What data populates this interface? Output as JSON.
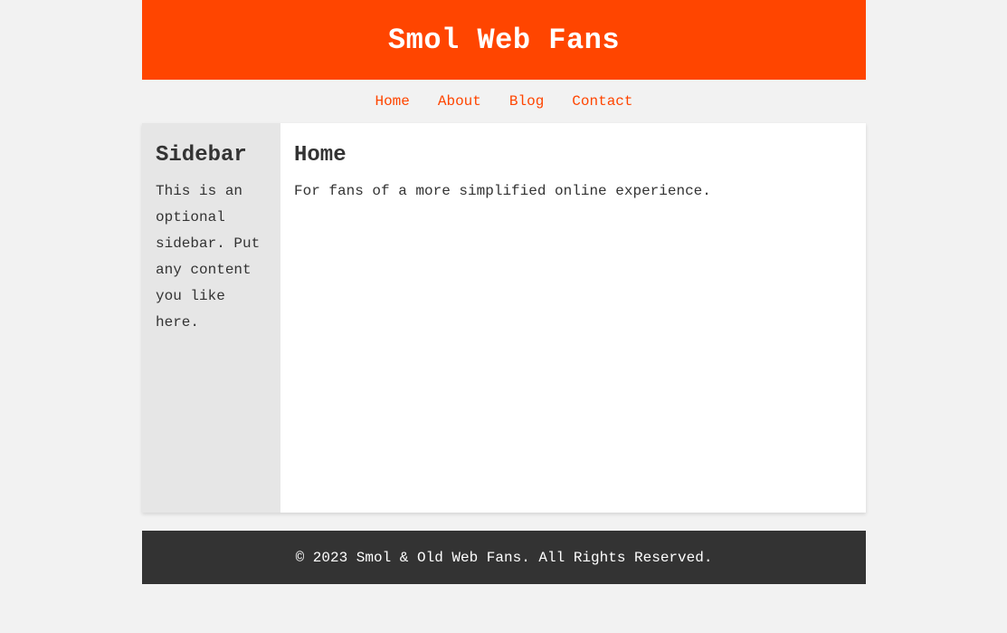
{
  "header": {
    "site_title": "Smol Web Fans"
  },
  "nav": {
    "items": [
      {
        "label": "Home"
      },
      {
        "label": "About"
      },
      {
        "label": "Blog"
      },
      {
        "label": "Contact"
      }
    ]
  },
  "sidebar": {
    "heading": "Sidebar",
    "text": "This is an optional sidebar. Put any content you like here."
  },
  "main": {
    "heading": "Home",
    "text": "For fans of a more simplified online experience."
  },
  "footer": {
    "text": "© 2023 Smol & Old Web Fans. All Rights Reserved."
  },
  "colors": {
    "accent": "#ff4500",
    "background": "#f2f2f2",
    "sidebar_bg": "#e6e6e6",
    "footer_bg": "#333333",
    "text": "#333333"
  }
}
